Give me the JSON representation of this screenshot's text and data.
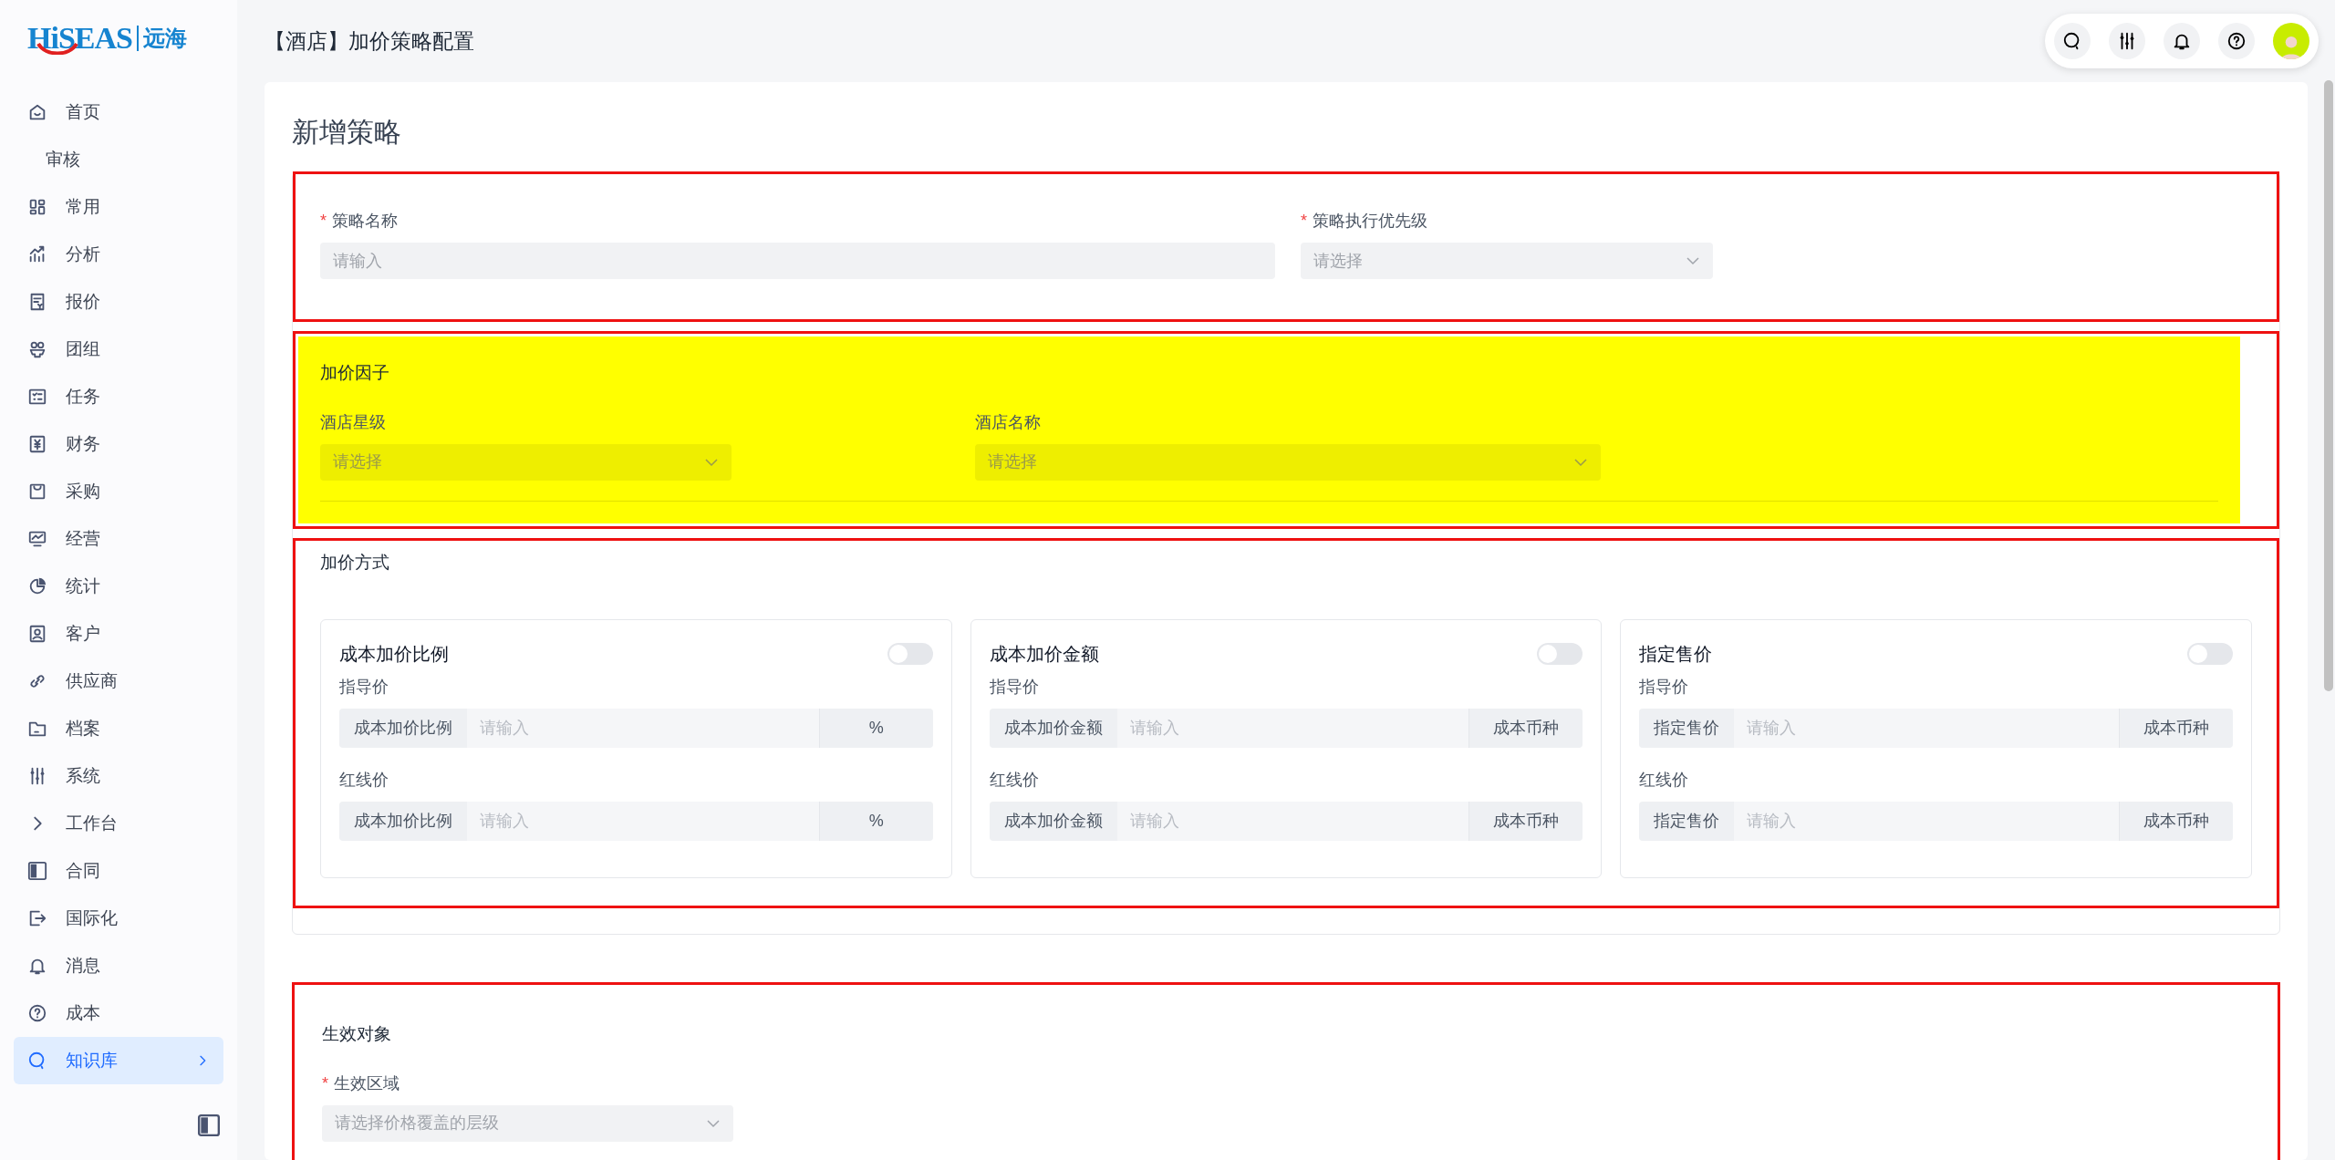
{
  "logo": {
    "brand": "HiSEAS",
    "suffix": "远海"
  },
  "sidebar": {
    "items": [
      {
        "label": "首页",
        "kind": "home",
        "selected": false
      },
      {
        "label": "审核",
        "kind": "none",
        "selected": false
      },
      {
        "label": "常用",
        "kind": "grid",
        "selected": false
      },
      {
        "label": "分析",
        "kind": "chart",
        "selected": false
      },
      {
        "label": "报价",
        "kind": "doc",
        "selected": false
      },
      {
        "label": "团组",
        "kind": "group",
        "selected": false
      },
      {
        "label": "任务",
        "kind": "tasks",
        "selected": false
      },
      {
        "label": "财务",
        "kind": "yen",
        "selected": false
      },
      {
        "label": "采购",
        "kind": "bag",
        "selected": false
      },
      {
        "label": "经营",
        "kind": "monitor",
        "selected": false
      },
      {
        "label": "统计",
        "kind": "pie",
        "selected": false
      },
      {
        "label": "客户",
        "kind": "contact",
        "selected": false
      },
      {
        "label": "供应商",
        "kind": "link",
        "selected": false
      },
      {
        "label": "档案",
        "kind": "folder",
        "selected": false
      },
      {
        "label": "系统",
        "kind": "sliders",
        "selected": false
      },
      {
        "label": "工作台",
        "kind": "chevron",
        "selected": false
      },
      {
        "label": "合同",
        "kind": "panel",
        "selected": false
      },
      {
        "label": "国际化",
        "kind": "exit",
        "selected": false
      },
      {
        "label": "消息",
        "kind": "bell",
        "selected": false
      },
      {
        "label": "成本",
        "kind": "help",
        "selected": false
      },
      {
        "label": "知识库",
        "kind": "search",
        "selected": true
      }
    ]
  },
  "header": {
    "title": "【酒店】加价策略配置",
    "actions": [
      {
        "kind": "search"
      },
      {
        "kind": "sliders"
      },
      {
        "kind": "bell"
      },
      {
        "kind": "help"
      },
      {
        "kind": "avatar"
      }
    ]
  },
  "form": {
    "title": "新增策略",
    "sections": [
      {
        "kind": "fields",
        "annotated": true,
        "fields": [
          {
            "required_mark": "*",
            "label": "策略名称",
            "kind": "text",
            "placeholder": "请输入"
          },
          {
            "required_mark": "*",
            "label": "策略执行优先级",
            "kind": "select",
            "placeholder": "请选择"
          }
        ]
      },
      {
        "kind": "fields",
        "title": "加价因子",
        "annotated": true,
        "highlighted": true,
        "fields": [
          {
            "label": "酒店星级",
            "kind": "select",
            "placeholder": "请选择"
          },
          {
            "label": "酒店名称",
            "kind": "select",
            "placeholder": "请选择"
          }
        ]
      },
      {
        "kind": "cards",
        "title": "加价方式",
        "annotated": true,
        "cards": [
          {
            "title": "成本加价比例",
            "on": false,
            "rows": [
              {
                "label": "指导价",
                "prefix": "成本加价比例",
                "placeholder": "请输入",
                "suffix": "%"
              },
              {
                "label": "红线价",
                "prefix": "成本加价比例",
                "placeholder": "请输入",
                "suffix": "%"
              }
            ]
          },
          {
            "title": "成本加价金额",
            "on": false,
            "rows": [
              {
                "label": "指导价",
                "prefix": "成本加价金额",
                "placeholder": "请输入",
                "suffix": "成本币种"
              },
              {
                "label": "红线价",
                "prefix": "成本加价金额",
                "placeholder": "请输入",
                "suffix": "成本币种"
              }
            ]
          },
          {
            "title": "指定售价",
            "on": false,
            "rows": [
              {
                "label": "指导价",
                "prefix": "指定售价",
                "placeholder": "请输入",
                "suffix": "成本币种"
              },
              {
                "label": "红线价",
                "prefix": "指定售价",
                "placeholder": "请输入",
                "suffix": "成本币种"
              }
            ]
          }
        ]
      },
      {
        "kind": "fields",
        "title": "生效对象",
        "annotated": true,
        "fields": [
          {
            "required_mark": "*",
            "label": "生效区域",
            "kind": "select",
            "placeholder": "请选择价格覆盖的层级"
          }
        ]
      }
    ]
  }
}
